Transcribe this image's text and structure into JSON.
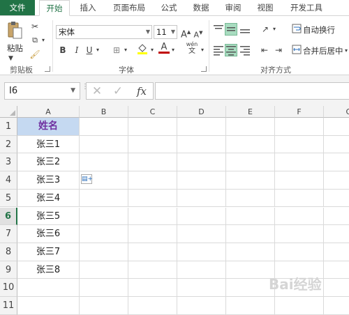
{
  "tabs": [
    "文件",
    "开始",
    "插入",
    "页面布局",
    "公式",
    "数据",
    "审阅",
    "视图",
    "开发工具"
  ],
  "clipboard": {
    "paste_label": "粘贴",
    "group_label": "剪贴板"
  },
  "font": {
    "family": "宋体",
    "size": "11",
    "bold": "B",
    "italic": "I",
    "underline": "U",
    "group_label": "字体",
    "phonetic": "wén"
  },
  "alignment": {
    "wrap_text": "自动换行",
    "merge_center": "合并后居中",
    "group_label": "对齐方式"
  },
  "name_box": {
    "value": "I6"
  },
  "formula_bar": {
    "cancel": "✕",
    "enter": "✓",
    "fx": "fx",
    "value": ""
  },
  "columns": [
    "A",
    "B",
    "C",
    "D",
    "E",
    "F",
    "G"
  ],
  "rows": [
    "1",
    "2",
    "3",
    "4",
    "5",
    "6",
    "7",
    "8",
    "9",
    "10",
    "11"
  ],
  "cells_A": [
    "姓名",
    "张三1",
    "张三2",
    "张三3",
    "张三4",
    "张三5",
    "张三6",
    "张三7",
    "张三8",
    "",
    ""
  ],
  "watermark": "Bai经验",
  "colors": {
    "excel_green": "#217346",
    "header_fill": "#c5d9f1",
    "header_text": "#7030a0",
    "selected_fill": "#a8dcc0"
  }
}
